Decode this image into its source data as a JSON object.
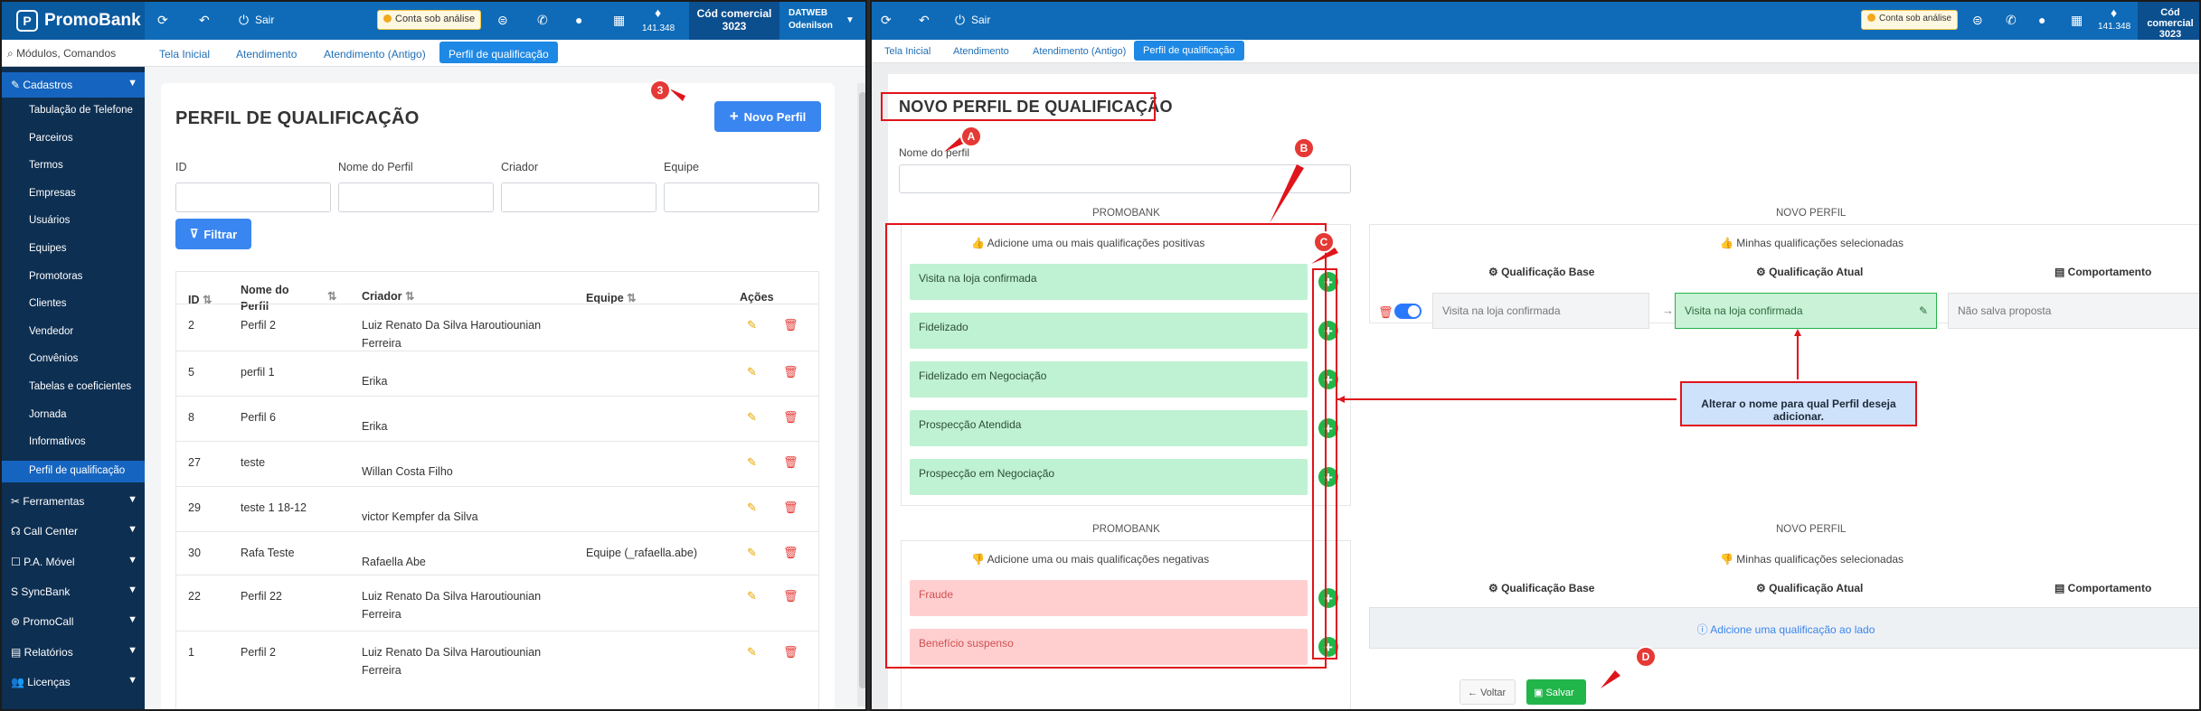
{
  "app": {
    "brand": "PromoBank",
    "sair": "Sair",
    "status_badge": "Conta sob análise",
    "counter": "141.348",
    "cod_title": "Cód comercial",
    "cod_value": "3023",
    "user_line1": "DATWEB",
    "user_line2": "Odenilson"
  },
  "left": {
    "tabs": [
      "Tela Inicial",
      "Atendimento",
      "Atendimento (Antigo)",
      "Perfil de qualificação"
    ],
    "search_placeholder": "Módulos, Comandos",
    "sidebar": {
      "cadastros": "Cadastros",
      "sub_items": [
        "Tabulação de Telefone",
        "Parceiros",
        "Termos",
        "Empresas",
        "Usuários",
        "Equipes",
        "Promotoras",
        "Clientes",
        "Vendedor",
        "Convênios",
        "Tabelas e coeficientes",
        "Jornada",
        "Informativos",
        "Perfil de qualificação"
      ],
      "sections": [
        "Ferramentas",
        "Call Center",
        "P.A. Móvel",
        "SyncBank",
        "PromoCall",
        "Relatórios",
        "Licenças"
      ]
    },
    "page_title": "PERFIL DE QUALIFICAÇÃO",
    "novo_perfil": "Novo Perfil",
    "filters": {
      "id": "ID",
      "nome": "Nome do Perfil",
      "criador": "Criador",
      "equipe": "Equipe",
      "filtrar": "Filtrar"
    },
    "table": {
      "headers": {
        "id": "ID",
        "nome": "Nome do Perfil",
        "criador": "Criador",
        "equipe": "Equipe",
        "acoes": "Ações"
      },
      "rows": [
        {
          "id": "2",
          "nome": "Perfil 2",
          "criador": "Luiz Renato Da Silva Haroutiounian Ferreira",
          "equipe": ""
        },
        {
          "id": "5",
          "nome": "perfil 1",
          "criador": "Erika",
          "equipe": ""
        },
        {
          "id": "8",
          "nome": "Perfil 6",
          "criador": "Erika",
          "equipe": ""
        },
        {
          "id": "27",
          "nome": "teste",
          "criador": "Willan Costa Filho",
          "equipe": ""
        },
        {
          "id": "29",
          "nome": "teste 1 18-12",
          "criador": "victor Kempfer da Silva",
          "equipe": ""
        },
        {
          "id": "30",
          "nome": "Rafa Teste",
          "criador": "Rafaella Abe",
          "equipe": "Equipe (_rafaella.abe)"
        },
        {
          "id": "22",
          "nome": "Perfil 22",
          "criador": "Luiz Renato Da Silva Haroutiounian Ferreira",
          "equipe": ""
        },
        {
          "id": "1",
          "nome": "Perfil 2",
          "criador": "Luiz Renato Da Silva Haroutiounian Ferreira",
          "equipe": ""
        }
      ]
    },
    "marker": "3"
  },
  "right": {
    "tabs": [
      "Tela Inicial",
      "Atendimento",
      "Atendimento (Antigo)",
      "Perfil de qualificação"
    ],
    "title": "NOVO PERFIL DE QUALIFICAÇÃO",
    "nome_label": "Nome do perfil",
    "promobank": "PROMOBANK",
    "novo_perfil": "NOVO PERFIL",
    "pos_title": "Adicione uma ou mais qualificações positivas",
    "neg_title": "Adicione uma ou mais qualificações negativas",
    "minhas": "Minhas qualificações selecionadas",
    "col_base": "Qualificação Base",
    "col_atual": "Qualificação Atual",
    "col_comp": "Comportamento",
    "positives": [
      "Visita na loja confirmada",
      "Fidelizado",
      "Fidelizado em Negociação",
      "Prospecção Atendida",
      "Prospecção em Negociação"
    ],
    "negatives": [
      "Fraude",
      "Benefício suspenso"
    ],
    "selected_base": "Visita na loja confirmada",
    "selected_atual": "Visita na loja confirmada",
    "selected_comp": "Não salva proposta",
    "neg_empty": "Adicione uma qualificação ao lado",
    "callout": "Alterar o nome para qual Perfil deseja adicionar.",
    "voltar": "Voltar",
    "salvar": "Salvar",
    "markers": {
      "a": "A",
      "b": "B",
      "c": "C",
      "d": "D"
    }
  }
}
